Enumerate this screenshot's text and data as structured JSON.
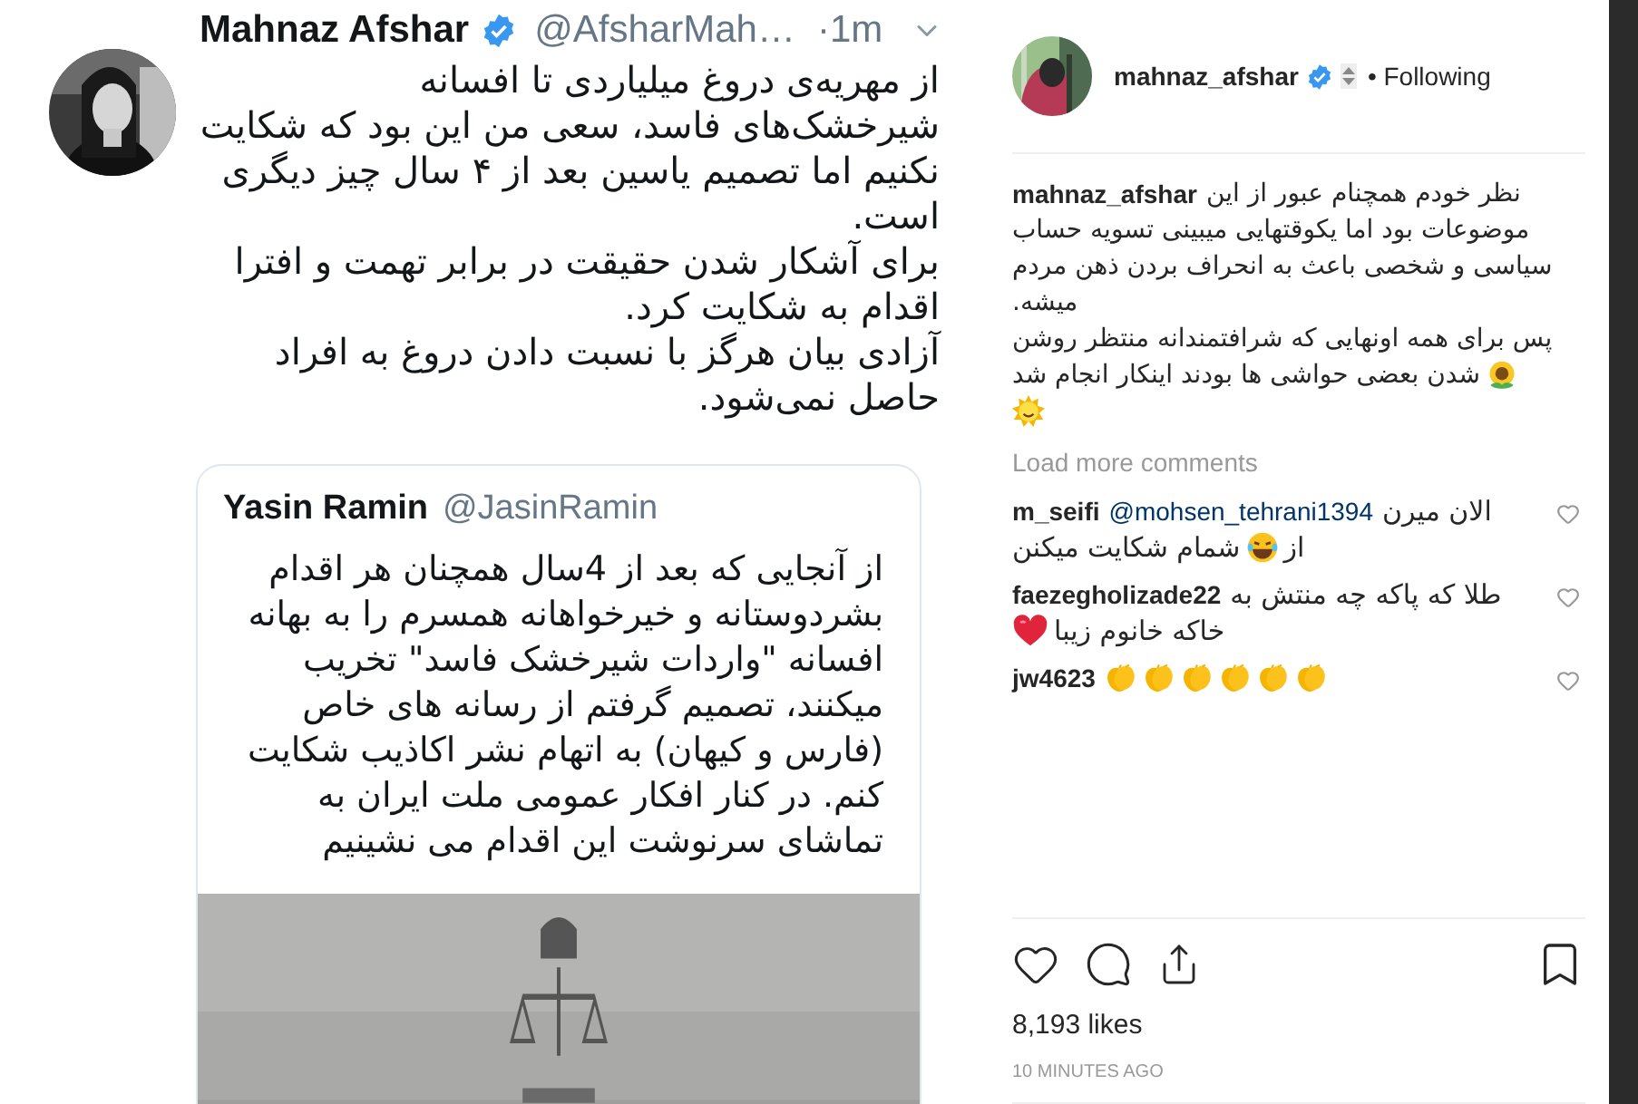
{
  "tweet": {
    "name": "Mahnaz Afshar",
    "verified": true,
    "handle": "@AfsharMah…",
    "time": "·1m",
    "lines": [
      "از مهریه‌ی دروغ میلیاردی تا افسانه",
      "شیرخشک‌های فاسد، سعی من این بود که شکایت",
      "نکنیم اما تصمیم یاسین بعد از ۴ سال چیز دیگری",
      "است.",
      "برای آشکار شدن حقیقت در برابر تهمت و افترا",
      "اقدام به شکایت کرد.",
      "آزادی بیان هرگز با نسبت دادن دروغ به افراد",
      "حاصل نمی‌شود."
    ],
    "quote": {
      "name": "Yasin Ramin",
      "handle": "@JasinRamin",
      "lines": [
        "از آنجایی که بعد از 4سال همچنان هر اقدام",
        "بشردوستانه و خیرخواهانه همسرم را به بهانه",
        "افسانه \"واردات شیرخشک فاسد\" تخریب",
        "میکنند، تصمیم گرفتم از رسانه های خاص",
        "(فارس و کیهان) به اتهام نشر اکاذیب شکایت",
        "کنم. در کنار افکار عمومی ملت ایران به",
        "تماشای سرنوشت این اقدام می نشینیم"
      ],
      "media": {
        "kind": "picture"
      }
    }
  },
  "post": {
    "user": "mahnaz_afshar",
    "verified": true,
    "follow_status": "• Following",
    "caption": {
      "user": "mahnaz_afshar",
      "lines": [
        {
          "parts": [
            {
              "kind": "text",
              "text": "نظر خودم همچنام عبور از این"
            }
          ]
        },
        {
          "parts": [
            {
              "kind": "text",
              "text": "موضوعات بود اما یکوقتهایی میبینی تسویه حساب"
            }
          ]
        },
        {
          "parts": [
            {
              "kind": "text",
              "text": "سیاسی و شخصی باعث به انحراف بردن ذهن مردم"
            }
          ]
        },
        {
          "parts": [
            {
              "kind": "text",
              "text": "میشه."
            }
          ]
        },
        {
          "parts": [
            {
              "kind": "text",
              "text": "پس برای همه اونهایی که شرافتمندانه منتظر روشن"
            }
          ]
        },
        {
          "parts": [
            {
              "kind": "sunflower"
            },
            {
              "kind": "text",
              "text": "شدن بعضی حواشی ها بودند اینکار انجام شد"
            }
          ]
        },
        {
          "parts": [
            {
              "kind": "sun"
            }
          ]
        }
      ]
    },
    "load_more": "Load more comments",
    "comments": [
      {
        "user": "m_seifi",
        "mention": "@mohsen_tehrani1394",
        "liked": false,
        "lines": [
          {
            "parts": [
              {
                "kind": "text",
                "text": "الان میرن"
              }
            ]
          },
          {
            "parts": [
              {
                "kind": "text",
                "text": "از"
              },
              {
                "kind": "laugh"
              },
              {
                "kind": "text",
                "text": "شمام شکایت میکنن"
              }
            ]
          }
        ]
      },
      {
        "user": "faezegholizade22",
        "liked": false,
        "lines": [
          {
            "parts": [
              {
                "kind": "text",
                "text": "طلا که پاکه چه منتش به"
              }
            ]
          },
          {
            "parts": [
              {
                "kind": "text",
                "text": "خاکه خانوم زیبا"
              },
              {
                "kind": "heart"
              }
            ]
          }
        ]
      },
      {
        "user": "jw4623",
        "liked": false,
        "lines": [
          {
            "parts": [
              {
                "kind": "clap"
              },
              {
                "kind": "clap"
              },
              {
                "kind": "clap"
              },
              {
                "kind": "clap"
              },
              {
                "kind": "clap"
              },
              {
                "kind": "clap"
              }
            ]
          }
        ]
      }
    ],
    "liked": false,
    "saved": false,
    "likes": "8,193 likes",
    "time": "10 MINUTES AGO"
  }
}
